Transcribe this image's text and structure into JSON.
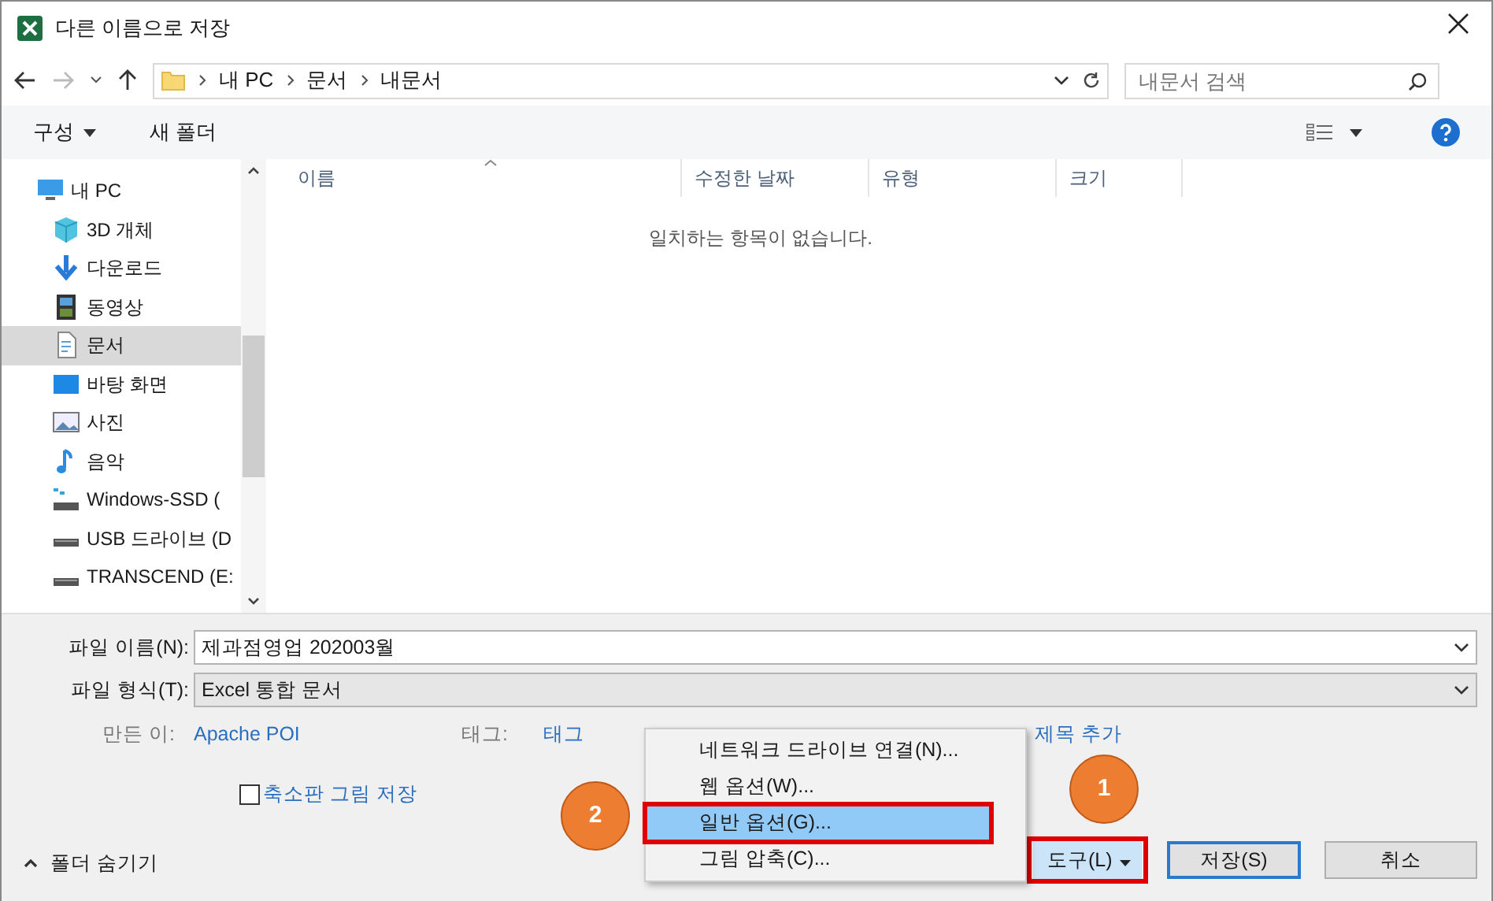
{
  "window": {
    "title": "다른 이름으로 저장"
  },
  "path": [
    "내 PC",
    "문서",
    "내문서"
  ],
  "search": {
    "placeholder": "내문서 검색"
  },
  "toolbar": {
    "organize": "구성",
    "new_folder": "새 폴더"
  },
  "sidebar": {
    "items": [
      {
        "label": "내 PC",
        "kind": "pc",
        "selected": false
      },
      {
        "label": "3D 개체",
        "kind": "cube",
        "selected": false
      },
      {
        "label": "다운로드",
        "kind": "download",
        "selected": false
      },
      {
        "label": "동영상",
        "kind": "video",
        "selected": false
      },
      {
        "label": "문서",
        "kind": "doc",
        "selected": true
      },
      {
        "label": "바탕 화면",
        "kind": "desktop",
        "selected": false
      },
      {
        "label": "사진",
        "kind": "picture",
        "selected": false
      },
      {
        "label": "음악",
        "kind": "music",
        "selected": false
      },
      {
        "label": "Windows-SSD (",
        "kind": "ssd",
        "selected": false
      },
      {
        "label": "USB 드라이브 (D",
        "kind": "drive",
        "selected": false
      },
      {
        "label": "TRANSCEND (E:",
        "kind": "drive",
        "selected": false
      }
    ]
  },
  "columns": [
    "이름",
    "수정한 날짜",
    "유형",
    "크기"
  ],
  "empty_message": "일치하는 항목이 없습니다.",
  "file_name": {
    "label": "파일 이름(N):",
    "value": "제과점영업 202003월"
  },
  "file_type": {
    "label": "파일 형식(T):",
    "value": "Excel 통합 문서"
  },
  "author": {
    "label": "만든 이:",
    "value": "Apache POI"
  },
  "tags": {
    "label": "태그:",
    "value": "태그"
  },
  "title_field": {
    "value": "제목 추가"
  },
  "thumbnail": {
    "label": "축소판 그림 저장",
    "checked": false
  },
  "hide_folders": "폴더 숨기기",
  "menu": [
    {
      "label": "네트워크 드라이브 연결(N)...",
      "selected": false
    },
    {
      "label": "웹 옵션(W)...",
      "selected": false
    },
    {
      "label": "일반 옵션(G)...",
      "selected": true
    },
    {
      "label": "그림 압축(C)...",
      "selected": false
    }
  ],
  "buttons": {
    "tools": "도구(L)",
    "save": "저장(S)",
    "cancel": "취소"
  },
  "callouts": [
    "1",
    "2"
  ]
}
